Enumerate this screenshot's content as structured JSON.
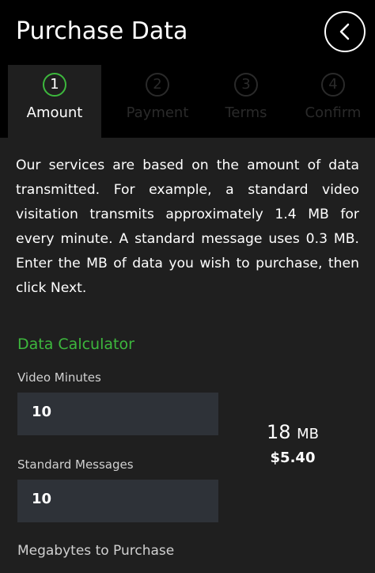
{
  "header": {
    "title": "Purchase Data",
    "back_icon": "chevron-left-icon"
  },
  "steps": [
    {
      "number": "1",
      "label": "Amount",
      "active": true
    },
    {
      "number": "2",
      "label": "Payment",
      "active": false
    },
    {
      "number": "3",
      "label": "Terms",
      "active": false
    },
    {
      "number": "4",
      "label": "Confirm",
      "active": false
    }
  ],
  "intro": "Our services are based on the amount of data transmitted. For example, a standard video visitation transmits approximately 1.4 MB for every minute. A standard message uses 0.3 MB. Enter the MB of data you wish to purchase, then click Next.",
  "calculator": {
    "title": "Data Calculator",
    "video_minutes_label": "Video Minutes",
    "video_minutes_value": "10",
    "messages_label": "Standard Messages",
    "messages_value": "10",
    "total_mb_value": "18",
    "total_mb_unit": "MB",
    "price": "$5.40"
  },
  "purchase": {
    "label": "Megabytes to Purchase"
  },
  "colors": {
    "accent_green": "#3db83d",
    "header_bg": "#000000",
    "body_bg": "#1f1f1f",
    "input_bg": "#2e3238",
    "inactive_step": "#2a2a2a"
  }
}
